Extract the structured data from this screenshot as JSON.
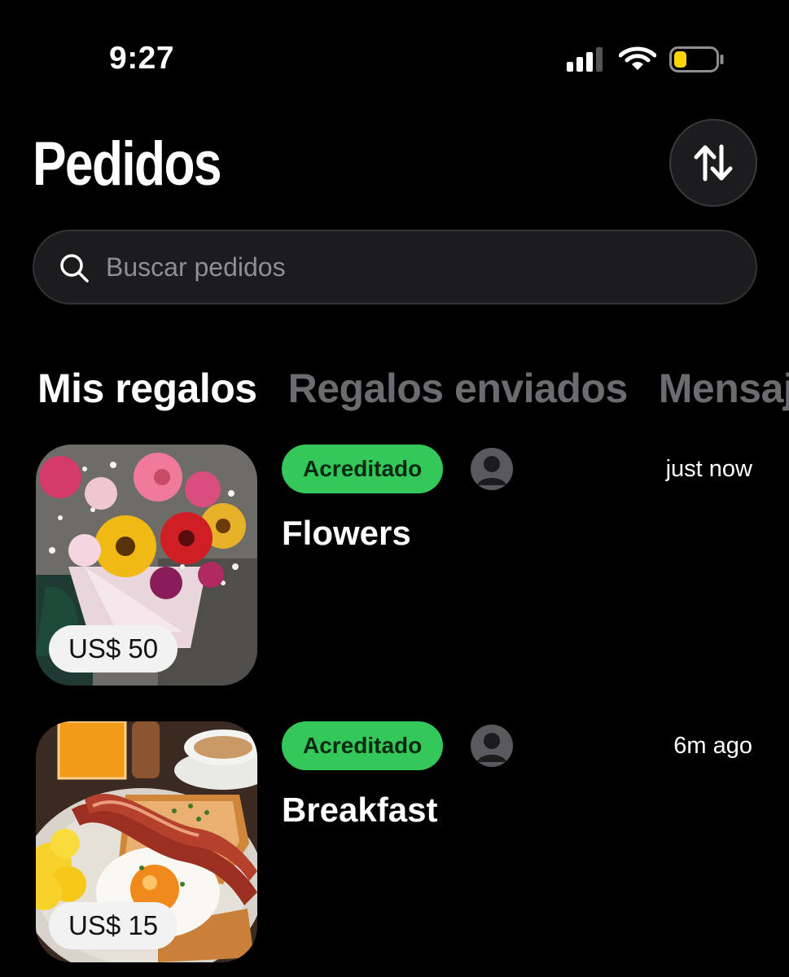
{
  "status_bar": {
    "time": "9:27",
    "signal_icon": "cellular-signal-icon",
    "wifi_icon": "wifi-icon",
    "battery_icon": "battery-low-icon",
    "battery_color": "#ffd60a"
  },
  "header": {
    "title": "Pedidos",
    "sort_icon": "sort-arrows-icon"
  },
  "search": {
    "placeholder": "Buscar pedidos",
    "value": "",
    "icon": "search-icon"
  },
  "tabs": [
    {
      "label": "Mis regalos",
      "active": true
    },
    {
      "label": "Regalos enviados",
      "active": false
    },
    {
      "label": "Mensajes",
      "active": false
    }
  ],
  "orders": [
    {
      "title": "Flowers",
      "price": "US$ 50",
      "status": "Acreditado",
      "time": "just now",
      "image": "flower-bouquet-photo",
      "avatar_icon": "user-avatar-icon"
    },
    {
      "title": "Breakfast",
      "price": "US$ 15",
      "status": "Acreditado",
      "time": "6m ago",
      "image": "breakfast-plate-photo",
      "avatar_icon": "user-avatar-icon"
    }
  ],
  "colors": {
    "background": "#000000",
    "status_green": "#34c759",
    "surface": "#1c1c1e",
    "inactive_tab": "#6c6c70"
  }
}
